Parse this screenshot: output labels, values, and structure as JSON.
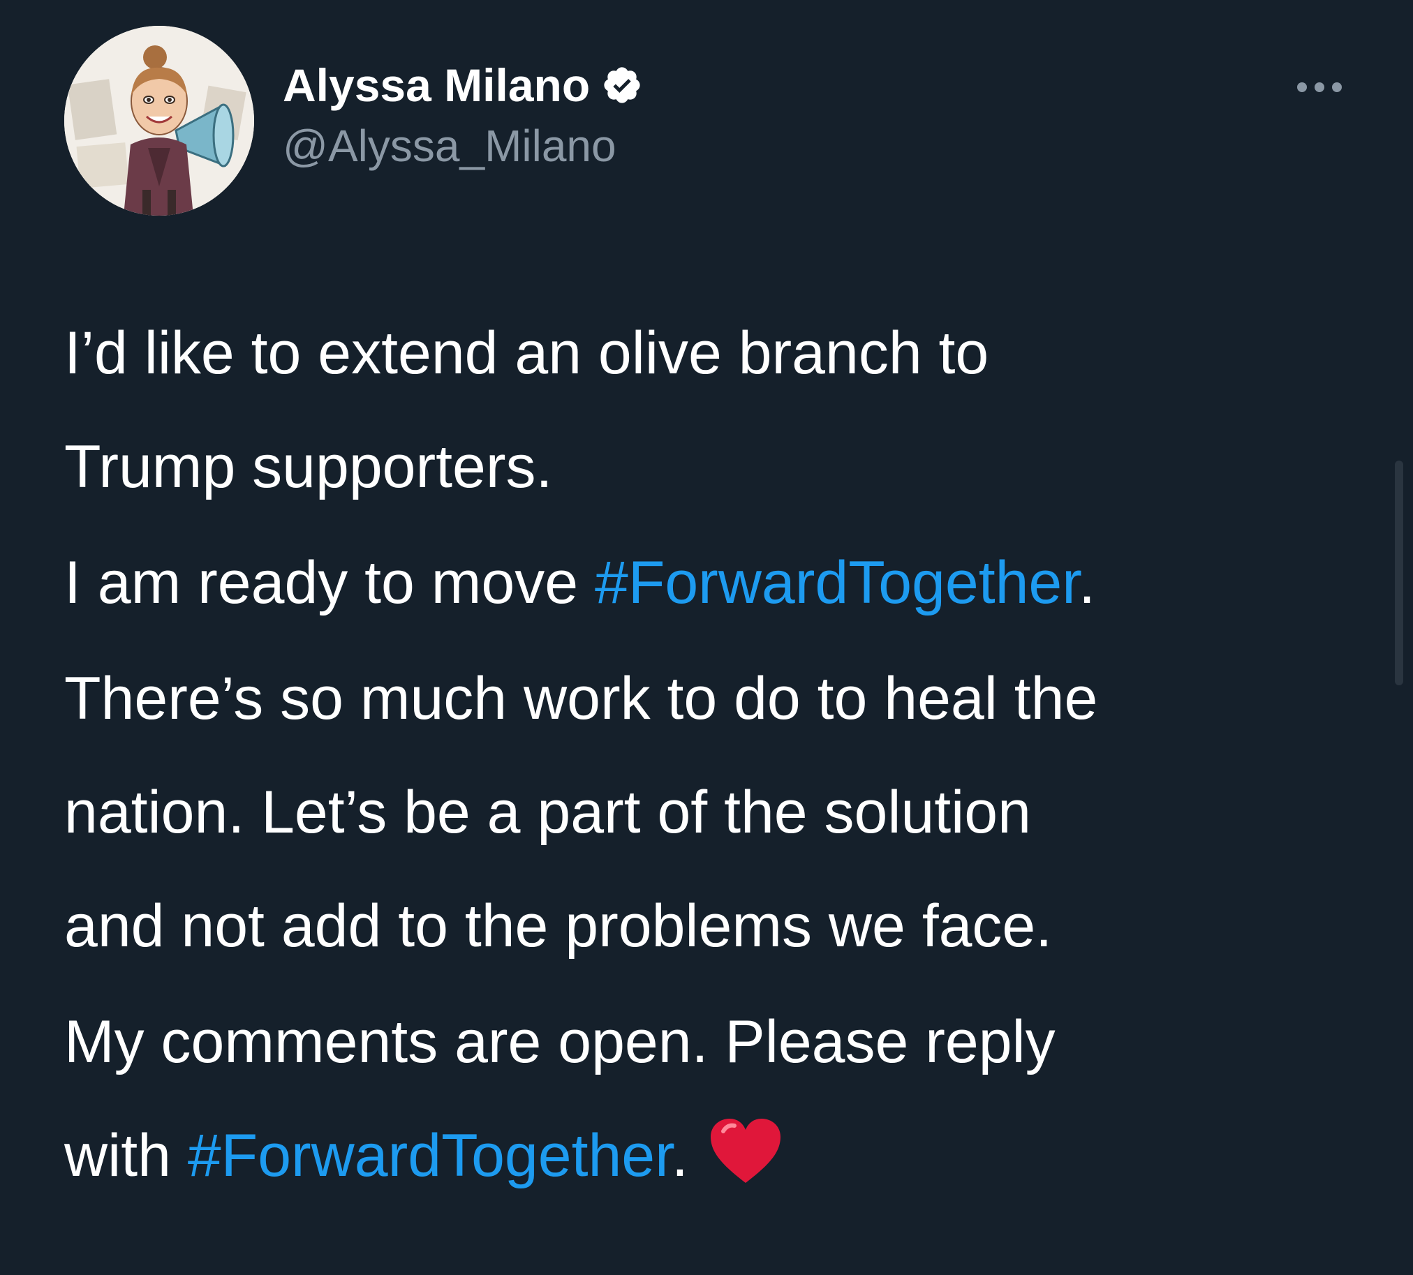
{
  "tweet": {
    "author": {
      "display_name": "Alyssa Milano",
      "handle": "@Alyssa_Milano",
      "verified": true,
      "avatar_icon": "caricature-avatar"
    },
    "more_icon": "more-dots-icon",
    "body": {
      "p1": "I’d like to extend an olive branch to",
      "p1_line2": "Trump supporters.",
      "p2_text": "I am ready to move ",
      "p2_hashtag": "#ForwardTogether",
      "p2_end": ".",
      "p3_line1": "There’s so much work to do to heal the",
      "p3_line2": "nation. Let’s be a part of the solution",
      "p3_line3": "and not add to the problems we face.",
      "p4_line1": "My comments are open. Please reply",
      "p4_text": "with ",
      "p4_hashtag": "#ForwardTogether",
      "p4_end": ".",
      "emoji_icon": "red-heart-icon"
    }
  },
  "colors": {
    "background": "#15202b",
    "text": "#ffffff",
    "secondary_text": "#8b98a5",
    "hashtag": "#1d9bf0",
    "heart": "#e0173a"
  }
}
